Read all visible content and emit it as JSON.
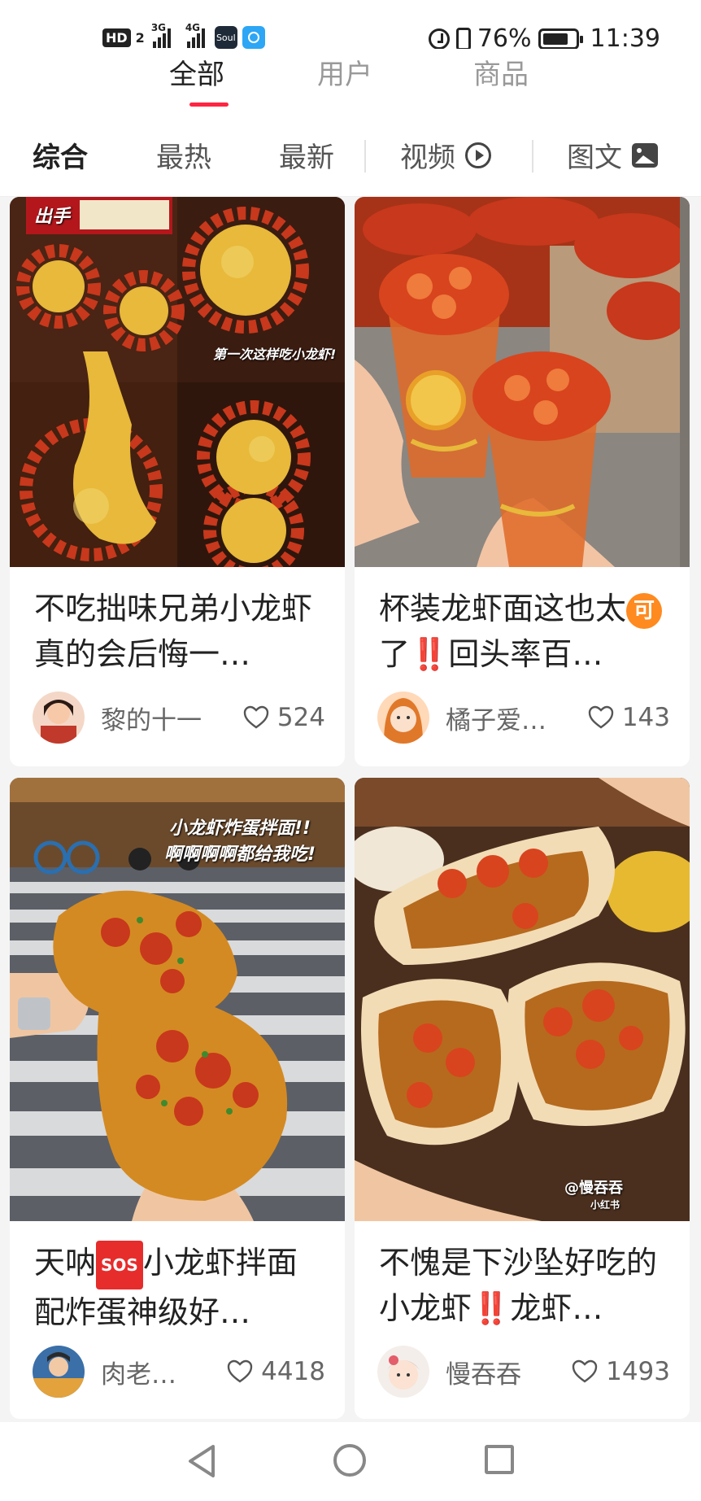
{
  "status_bar": {
    "hd_label": "HD",
    "hd_sub": "2",
    "net1": "3G",
    "net2": "4G",
    "soul_label": "Soul",
    "battery_percent": "76%",
    "time": "11:39"
  },
  "top_tabs": [
    "全部",
    "用户",
    "商品"
  ],
  "filter_tabs": [
    "综合",
    "最热",
    "最新",
    "视频",
    "图文"
  ],
  "feed": [
    {
      "title_parts": [
        "不吃拙味兄弟小龙虾真的会后悔一…"
      ],
      "author": "黎的十一",
      "likes": "524",
      "overlays": [
        "出手",
        "第一次这样吃小龙虾!"
      ]
    },
    {
      "title_parts": [
        "杯装龙虾面这也太",
        "可",
        "了",
        "‼️",
        "回头率百…"
      ],
      "author": "橘子爱…",
      "likes": "143",
      "overlays": []
    },
    {
      "title_parts": [
        "天呐",
        "SOS",
        "小龙虾拌面配炸蛋神级好…"
      ],
      "author": "肉老…",
      "likes": "4418",
      "overlays": [
        "小龙虾炸蛋拌面!!",
        "啊啊啊啊都给我吃!"
      ]
    },
    {
      "title_parts": [
        "不愧是下沙坠好吃的小龙虾",
        "‼️",
        "龙虾…"
      ],
      "author": "慢吞吞",
      "likes": "1493",
      "overlays": [
        "@慢吞吞",
        "小红书"
      ]
    }
  ],
  "colors": {
    "accent": "#ff2442",
    "crayfish": "#c8381c",
    "noodle": "#e8b93a"
  }
}
